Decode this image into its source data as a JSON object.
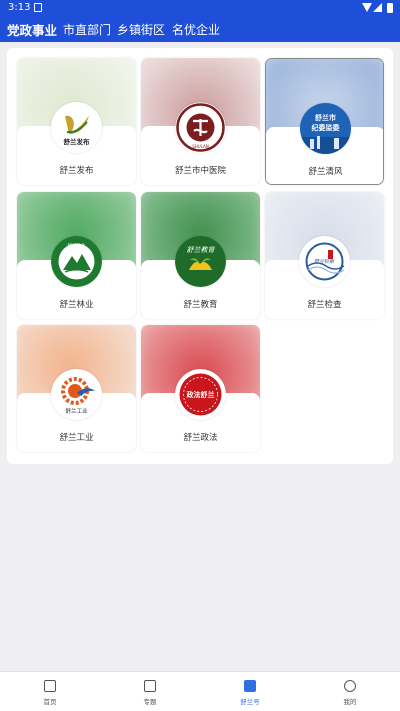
{
  "status_bar": {
    "time": "3:13"
  },
  "top_tabs": [
    {
      "label": "党政事业",
      "active": true
    },
    {
      "label": "市直部门",
      "active": false
    },
    {
      "label": "乡镇街区",
      "active": false
    },
    {
      "label": "名优企业",
      "active": false
    }
  ],
  "accounts": [
    {
      "name": "舒兰发布",
      "logo_text": "舒兰发布",
      "accent": "#2e7d32",
      "bg": "#eef3e6"
    },
    {
      "name": "舒兰市中医院",
      "logo_text": "SHULAN",
      "accent": "#7b1e1e",
      "bg": "#d9b7b7"
    },
    {
      "name": "舒兰清风",
      "logo_text_top": "舒兰市",
      "logo_text_bottom": "纪委监委",
      "accent": "#1e63b6",
      "bg": "#b9cbe6"
    },
    {
      "name": "舒兰林业",
      "logo_text": "舒兰林业",
      "accent": "#1d7a2e",
      "bg": "#7dc28a"
    },
    {
      "name": "舒兰教育",
      "logo_text": "舒兰教育",
      "accent": "#1f6b2a",
      "bg": "#73b07c"
    },
    {
      "name": "舒兰检查",
      "logo_text": "舒兰检察",
      "accent": "#2a5a9e",
      "bg": "#c9d6e8"
    },
    {
      "name": "舒兰工业",
      "logo_text": "舒兰工业",
      "accent": "#e05a1c",
      "bg": "#f2c9b0"
    },
    {
      "name": "舒兰政法",
      "logo_text": "政法舒兰",
      "accent": "#c9161d",
      "bg": "#e98c8f"
    }
  ],
  "bottom_nav": [
    {
      "label": "首页",
      "icon": "home-icon",
      "active": false
    },
    {
      "label": "专题",
      "icon": "topic-icon",
      "active": false
    },
    {
      "label": "舒兰号",
      "icon": "shulan-account-icon",
      "active": true
    },
    {
      "label": "我的",
      "icon": "profile-icon",
      "active": false
    }
  ]
}
